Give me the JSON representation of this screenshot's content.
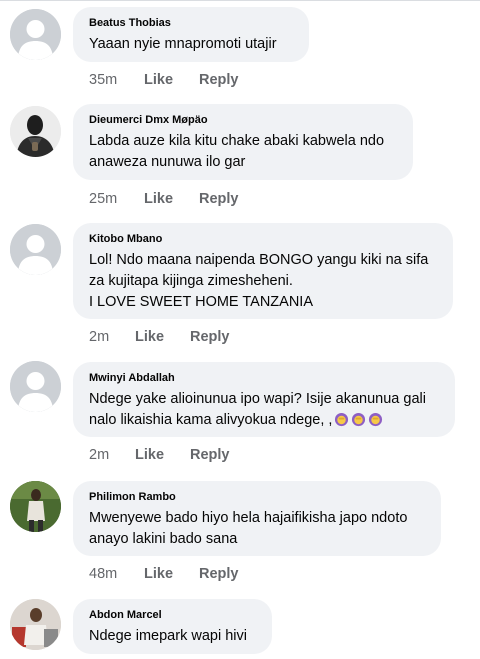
{
  "comments": [
    {
      "name": "Beatus Thobias",
      "text": "Yaaan nyie mnapromoti utajir",
      "time": "35m",
      "like": "Like",
      "reply": "Reply",
      "avatar": "default-avatar"
    },
    {
      "name": "Dieumerci Dmx Møpäo",
      "text": "Labda auze kila kitu chake abaki kabwela ndo\nanaweza nunuwa ilo gar",
      "time": "25m",
      "like": "Like",
      "reply": "Reply",
      "avatar": "photo-avatar"
    },
    {
      "name": "Kitobo Mbano",
      "text": "Lol! Ndo maana naipenda BONGO yangu kiki na sifa\nza kujitapa kijinga zimesheheni.\nI LOVE SWEET HOME TANZANIA",
      "time": "2m",
      "like": "Like",
      "reply": "Reply",
      "avatar": "default-avatar"
    },
    {
      "name": "Mwinyi Abdallah",
      "text": "Ndege yake alioinunua ipo wapi? Isije akanunua gali\nnalo likaishia kama alivyokua ndege, ,",
      "emojis": [
        "woman-facepalming-emoji",
        "woman-facepalming-emoji",
        "woman-facepalming-emoji"
      ],
      "time": "2m",
      "like": "Like",
      "reply": "Reply",
      "avatar": "default-avatar"
    },
    {
      "name": "Philimon Rambo",
      "text": "Mwenyewe bado hiyo hela hajaifikisha japo ndoto\nanayo lakini bado sana",
      "time": "48m",
      "like": "Like",
      "reply": "Reply",
      "avatar": "photo-avatar"
    },
    {
      "name": "Abdon Marcel",
      "text": "Ndege imepark wapi hivi",
      "avatar": "photo-avatar"
    }
  ],
  "colors": {
    "bubble": "#f0f2f5",
    "meta": "#65676b",
    "text": "#050505",
    "default_avatar": "#ccd0d5"
  }
}
